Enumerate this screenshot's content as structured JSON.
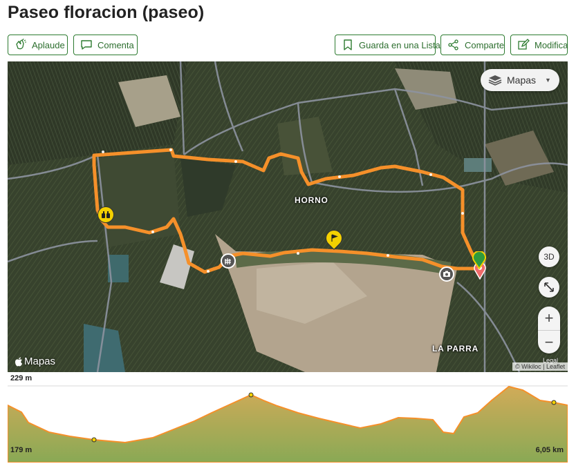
{
  "page": {
    "title": "Paseo floracion (paseo)"
  },
  "actions": {
    "aplaude": "Aplaude",
    "comenta": "Comenta",
    "guarda": "Guarda en una Lista",
    "comparte": "Comparte",
    "modifica": "Modifica"
  },
  "map": {
    "layer_select": "Mapas",
    "btn_3d": "3D",
    "zoom_in": "+",
    "zoom_out": "−",
    "places": [
      "HORNO",
      "LA PARRA"
    ],
    "provider": "Mapas",
    "legal": "Legal",
    "attribution": "© Wikiloc | Leaflet",
    "route_color": "#f5902a",
    "icons": [
      "binoculars-icon",
      "flag-icon",
      "fence-icon",
      "camera-icon",
      "start-pin-icon",
      "end-pin-icon"
    ]
  },
  "elevation": {
    "max_label": "229 m",
    "min_label": "179 m",
    "distance_label": "6,05 km",
    "fill_color": "#8aa84a",
    "line_color": "#f5902a"
  }
}
